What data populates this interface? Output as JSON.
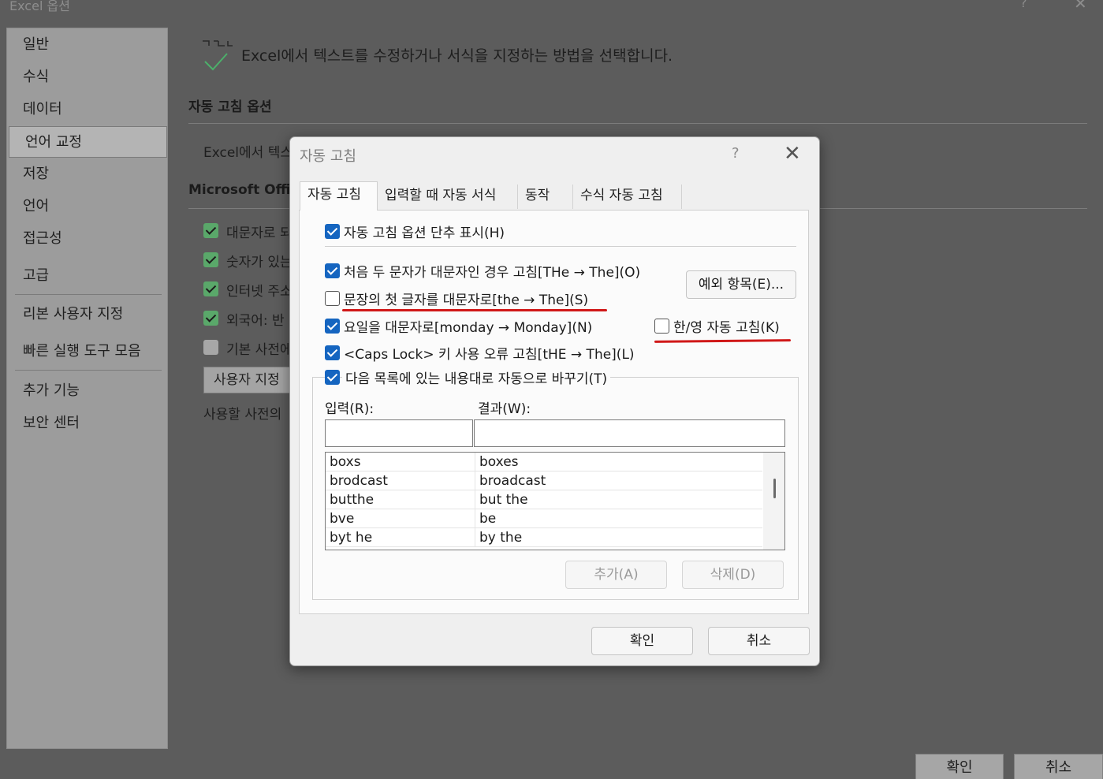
{
  "window": {
    "title": "Excel 옵션",
    "help": "?",
    "close": "✕"
  },
  "sidebar": {
    "items": [
      {
        "label": "일반"
      },
      {
        "label": "수식"
      },
      {
        "label": "데이터"
      },
      {
        "label": "언어 교정",
        "active": true
      },
      {
        "label": "저장"
      },
      {
        "label": "언어"
      },
      {
        "label": "접근성"
      },
      {
        "label": "고급"
      },
      {
        "label": "리본 사용자 지정"
      },
      {
        "label": "빠른 실행 도구 모음"
      },
      {
        "label": "추가 기능"
      },
      {
        "label": "보안 센터"
      }
    ]
  },
  "main": {
    "title": "Excel에서 텍스트를 수정하거나 서식을 지정하는 방법을 선택합니다.",
    "autocorrect_heading": "자동 고침 옵션",
    "autocorrect_desc": "Excel에서 텍스",
    "office_heading": "Microsoft Offic",
    "options": [
      {
        "label": "대문자로 되",
        "checked": true
      },
      {
        "label": "숫자가 있는",
        "checked": true
      },
      {
        "label": "인터넷 주소",
        "checked": true
      },
      {
        "label": "외국어: 반",
        "checked": true
      },
      {
        "label": "기본 사전에",
        "checked": false
      }
    ],
    "custom_dict_button": "사용자 지정",
    "dict_lang_label": "사용할 사전의"
  },
  "footer": {
    "ok": "확인",
    "cancel": "취소"
  },
  "dialog": {
    "title": "자동 고침",
    "help": "?",
    "close": "✕",
    "tabs": [
      "자동 고침",
      "입력할 때 자동 서식",
      "동작",
      "수식 자동 고침"
    ],
    "show_buttons": {
      "label": "자동 고침 옵션 단추 표시(H)",
      "checked": true
    },
    "two_initial_caps": {
      "label": "처음 두 문자가 대문자인 경우 고침[THe → The](O)",
      "checked": true
    },
    "exceptions_button": "예외 항목(E)...",
    "capitalize_first": {
      "label": "문장의 첫 글자를 대문자로[the → The](S)",
      "checked": false
    },
    "capitalize_days": {
      "label": "요일을 대문자로[monday → Monday](N)",
      "checked": true
    },
    "hangul_english": {
      "label": "한/영 자동 고침(K)",
      "checked": false
    },
    "caps_lock": {
      "label": "<Caps Lock> 키 사용 오류 고침[tHE → The](L)",
      "checked": true
    },
    "replace_text": {
      "label": "다음 목록에 있는 내용대로 자동으로 바꾸기(T)",
      "checked": true
    },
    "replace_label": "입력(R):",
    "with_label": "결과(W):",
    "replace_value": "",
    "with_value": "",
    "entries": [
      {
        "replace": "boxs",
        "with": "boxes"
      },
      {
        "replace": "brodcast",
        "with": "broadcast"
      },
      {
        "replace": "butthe",
        "with": "but the"
      },
      {
        "replace": "bve",
        "with": "be"
      },
      {
        "replace": "byt he",
        "with": "by the"
      }
    ],
    "add_button": "추가(A)",
    "delete_button": "삭제(D)",
    "ok": "확인",
    "cancel": "취소"
  },
  "colors": {
    "accent": "#1565c0",
    "annotation": "#d01818",
    "dim_check": "#5aa86a"
  }
}
